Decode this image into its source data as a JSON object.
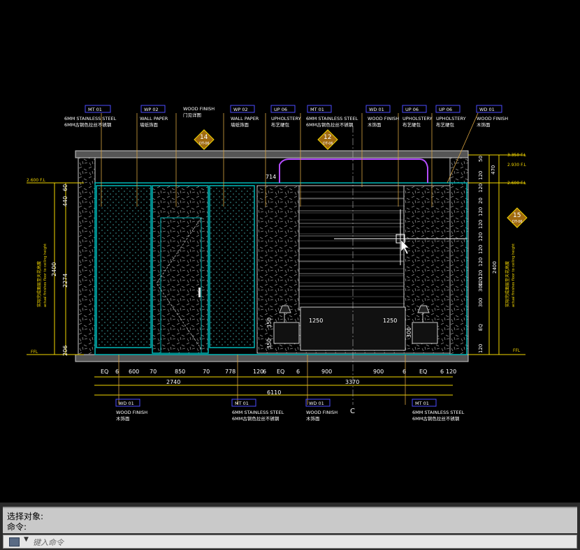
{
  "drawing": {
    "tags": [
      {
        "code": "MT 01",
        "en": "6MM STAINLESS STEEL",
        "cn": "6MM古铜色拉丝不锈钢"
      },
      {
        "code": "WP 02",
        "en": "WALL PAPER",
        "cn": "墙纸饰面"
      },
      {
        "code": "",
        "en": "WOOD FINISH",
        "cn": "门见详图"
      },
      {
        "code": "WP 02",
        "en": "WALL PAPER",
        "cn": "墙纸饰面"
      },
      {
        "code": "UP 06",
        "en": "UPHOLSTERY",
        "cn": "布艺硬包"
      },
      {
        "code": "MT 01",
        "en": "6MM STAINLESS STEEL",
        "cn": "6MM古铜色拉丝不锈钢"
      },
      {
        "code": "WD 01",
        "en": "WOOD FINISH",
        "cn": "木饰面"
      },
      {
        "code": "UP 06",
        "en": "UPHOLSTERY",
        "cn": "布艺硬包"
      },
      {
        "code": "UP 06",
        "en": "UPHOLSTERY",
        "cn": "布艺硬包"
      },
      {
        "code": "WD 01",
        "en": "WOOD FINISH",
        "cn": "木饰面"
      }
    ],
    "bottom_tags": [
      {
        "code": "WD 01",
        "en": "WOOD FINISH",
        "cn": "木饰面"
      },
      {
        "code": "MT 01",
        "en": "6MM STAINLESS STEEL",
        "cn": "6MM古铜色拉丝不锈钢"
      },
      {
        "code": "WD 01",
        "en": "WOOD FINISH",
        "cn": "木饰面"
      },
      {
        "code": "MT 01",
        "en": "6MM STAINLESS STEEL",
        "cn": "6MM古铜色拉丝不锈钢"
      }
    ],
    "section_markers": [
      {
        "num": "14",
        "ref": "DT-06"
      },
      {
        "num": "12",
        "ref": "DT-06"
      },
      {
        "num": "15",
        "ref": "DT-06"
      }
    ],
    "bottom_dims_row1": [
      "EQ",
      "6",
      "600",
      "70",
      "850",
      "70",
      "778",
      "120",
      "6",
      "EQ",
      "6",
      "900",
      "900",
      "6",
      "EQ",
      "6",
      "120"
    ],
    "bottom_dims_row2": [
      "2740",
      "3370"
    ],
    "bottom_dims_row3": [
      "6110"
    ],
    "centerline": "C",
    "left_dims": [
      "440",
      "60",
      "2274",
      "2400",
      "206"
    ],
    "left_level_labels": [
      "2.600 F.L",
      "FFL"
    ],
    "left_vertical_note": [
      "实际完成面层至天花高度",
      "actual finishes floor to ceiling height"
    ],
    "right_dims": [
      "50",
      "470",
      "120",
      "120",
      "20",
      "120",
      "120",
      "120",
      "120",
      "120",
      "120",
      "120",
      "300",
      "300",
      "EQ",
      "120",
      "2400"
    ],
    "right_level_labels": [
      "3.350 F.L",
      "2.930 F.L",
      "2.600 F.L",
      "FFL"
    ],
    "right_vertical_note": [
      "实际完成面层至天花高度",
      "actual finishes floor to ceiling height"
    ],
    "interior_dims": [
      "714",
      "350",
      "350",
      "1250",
      "1250",
      "300"
    ]
  },
  "command_line": {
    "history": [
      "选择对象:",
      "命令:"
    ],
    "placeholder": "键入命令"
  },
  "colors": {
    "background": "#000000",
    "dims": "#f5d800",
    "text_white": "#ffffff",
    "panel": "#00b7b7",
    "leader": "#d9a441",
    "tag_box": "#4d4dff"
  }
}
